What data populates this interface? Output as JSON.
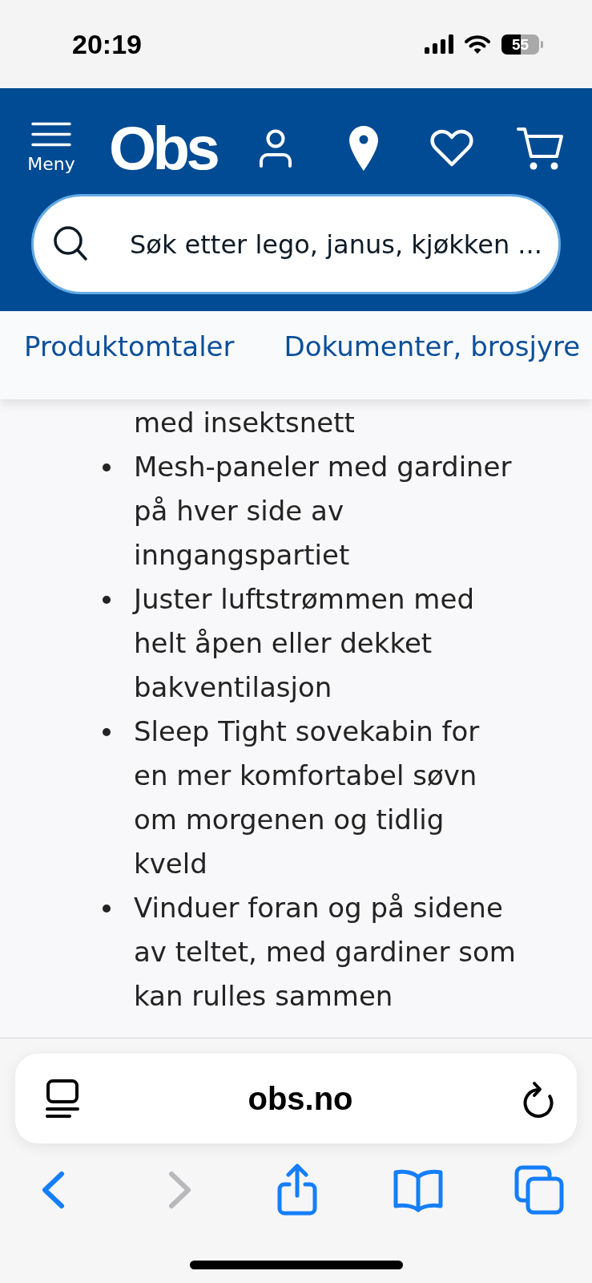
{
  "status_bar": {
    "time": "20:19",
    "battery": "55"
  },
  "header": {
    "menu_label": "Meny",
    "logo": "Obs",
    "search": {
      "placeholder": "Søk etter lego, janus, kjøkken ..."
    }
  },
  "section_links": [
    {
      "label": "Produktomtaler"
    },
    {
      "label": "Dokumenter, brosjyre"
    }
  ],
  "description": {
    "items": [
      {
        "kind": "continuation",
        "text": "med insektsnett"
      },
      {
        "kind": "bullet",
        "text": "Mesh-paneler med gardiner\npå hver side av\ninngangspartiet"
      },
      {
        "kind": "bullet",
        "text": "Juster luftstrømmen med\nhelt åpen eller dekket\nbakventilasjon"
      },
      {
        "kind": "bullet",
        "text": "Sleep Tight sovekabin for\nen mer komfortabel søvn\nom morgenen og tidlig\nkveld"
      },
      {
        "kind": "bullet",
        "text": "Vinduer foran og på sidene\nav teltet, med gardiner som\nkan rulles sammen"
      }
    ]
  },
  "browser": {
    "address": "obs.no",
    "toolbar": [
      {
        "kind": "back",
        "disabled": false
      },
      {
        "kind": "forward",
        "disabled": true
      },
      {
        "kind": "share",
        "disabled": false
      },
      {
        "kind": "bookmarks",
        "disabled": false
      },
      {
        "kind": "tabs",
        "disabled": false
      }
    ]
  }
}
